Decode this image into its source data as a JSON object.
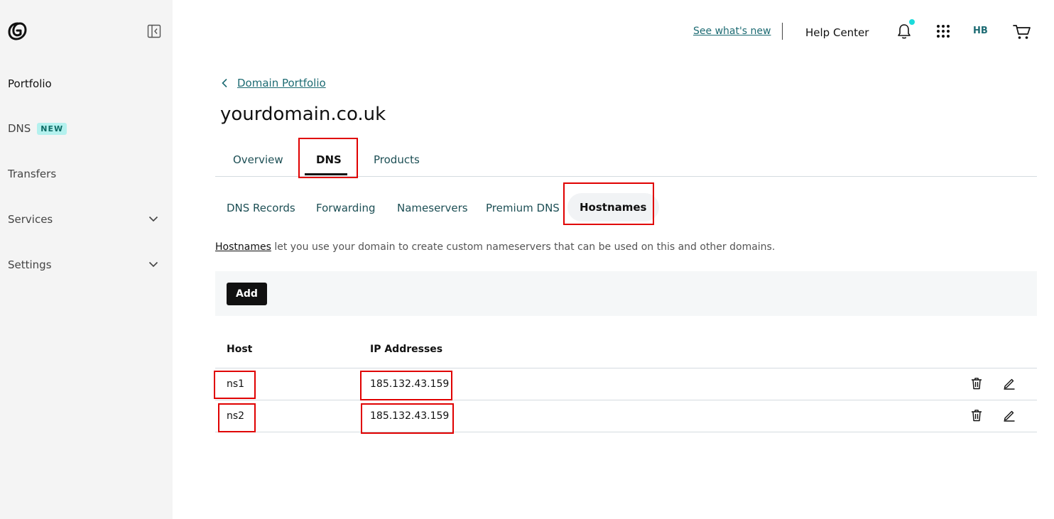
{
  "sidebar": {
    "items": [
      {
        "label": "Portfolio"
      },
      {
        "label": "DNS",
        "badge": "NEW"
      },
      {
        "label": "Transfers"
      },
      {
        "label": "Services"
      },
      {
        "label": "Settings"
      }
    ]
  },
  "header": {
    "whats_new": "See what's new",
    "help_center": "Help Center",
    "avatar_initials": "HB"
  },
  "breadcrumb": {
    "label": "Domain Portfolio"
  },
  "page": {
    "title": "yourdomain.co.uk"
  },
  "tabs": [
    {
      "label": "Overview"
    },
    {
      "label": "DNS"
    },
    {
      "label": "Products"
    }
  ],
  "subtabs": [
    {
      "label": "DNS Records"
    },
    {
      "label": "Forwarding"
    },
    {
      "label": "Nameservers"
    },
    {
      "label": "Premium DNS"
    },
    {
      "label": "Hostnames"
    }
  ],
  "description": {
    "link": "Hostnames",
    "text": " let you use your domain to create custom nameservers that can be used on this and other domains."
  },
  "toolbar": {
    "add_label": "Add"
  },
  "table": {
    "headers": {
      "host": "Host",
      "ip": "IP Addresses"
    },
    "rows": [
      {
        "host": "ns1",
        "ip": "185.132.43.159"
      },
      {
        "host": "ns2",
        "ip": "185.132.43.159"
      }
    ]
  },
  "colors": {
    "accent": "#1d6b73",
    "badge_bg": "#b4f1ee",
    "annotation": "#e00000"
  }
}
